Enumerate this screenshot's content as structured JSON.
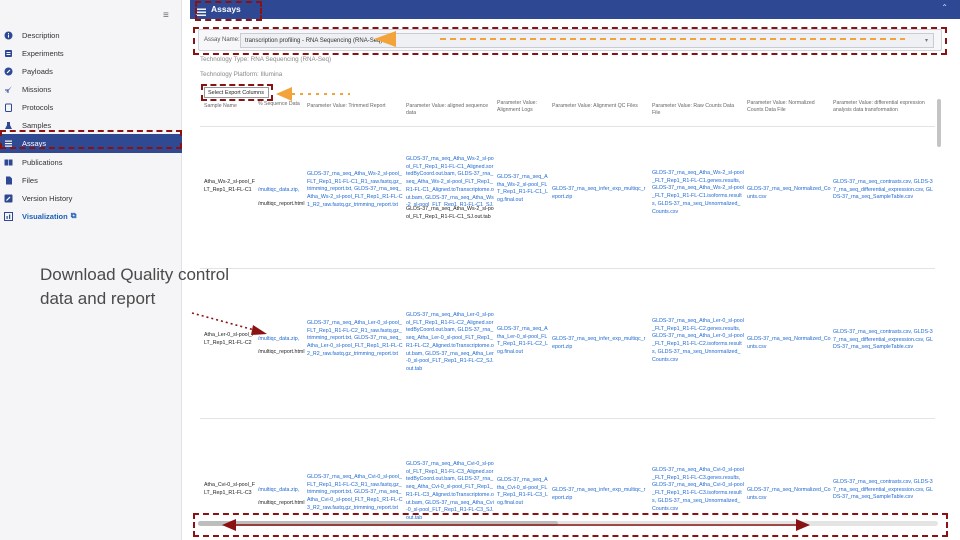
{
  "sidebar": {
    "items": [
      {
        "label": "Description",
        "icon": "info-circle-icon"
      },
      {
        "label": "Experiments",
        "icon": "flask-icon"
      },
      {
        "label": "Payloads",
        "icon": "rocket-icon"
      },
      {
        "label": "Missions",
        "icon": "rocket-launch-icon"
      },
      {
        "label": "Protocols",
        "icon": "clipboard-icon"
      },
      {
        "label": "Samples",
        "icon": "beaker-icon"
      },
      {
        "label": "Assays",
        "icon": "list-icon"
      },
      {
        "label": "Publications",
        "icon": "book-icon"
      },
      {
        "label": "Files",
        "icon": "file-icon"
      },
      {
        "label": "Version History",
        "icon": "edit-icon"
      },
      {
        "label": "Visualization",
        "icon": "chart-icon"
      }
    ],
    "active": "Assays"
  },
  "header": {
    "title": "Assays"
  },
  "assay": {
    "label": "Assay Name:",
    "value": "transcription profiling - RNA Sequencing (RNA-Seq)"
  },
  "technology_type": "Technology Type: RNA Sequencing (RNA-Seq)",
  "technology_platform": "Technology Platform: Illumina",
  "export_button": "Select Export Columns",
  "table": {
    "headers": [
      "Sample Name",
      "% Sequence Data",
      "Parameter Value: Trimmed Report",
      "Parameter Value: aligned sequence data",
      "Parameter Value: Alignment Logs",
      "Parameter Value: Alignment QC Files",
      "Parameter Value: Raw Counts Data File",
      "Parameter Value: Normalized Counts Data File",
      "Parameter Value: differential expression analysis data transformation"
    ],
    "rows": [
      {
        "sample": "Atha_Ws-2_sl-pool_FLT_Rep1_R1-FL-C1",
        "seq1": "/multiqc_data.zip,",
        "seq2": "/multiqc_report.html",
        "trimmed": "GLDS-37_rna_seq_Atha_Ws-2_sl-pool_FLT_Rep1_R1-FL-C1_R1_raw.fastq.gz_trimming_report.txt, GLDS-37_rna_seq_Atha_Ws-2_sl-pool_FLT_Rep1_R1-FL-C1_R2_raw.fastq.gz_trimming_report.txt",
        "aligned": "GLDS-37_rna_seq_Atha_Ws-2_sl-pool_FLT_Rep1_R1-FL-C1_Aligned.sortedByCoord.out.bam, GLDS-37_rna_seq_Atha_Ws-2_sl-pool_FLT_Rep1_R1-FL-C1_Aligned.toTranscriptome.out.bam, GLDS-37_rna_seq_Atha_Ws-2_sl-pool_FLT_Rep1_R1-FL-C1_SJ.out.tab",
        "aligned_dark": "GLDS-37_rna_seq_Atha_Ws-2_sl-pool_FLT_Rep1_R1-FL-C1_SJ.out.tab",
        "logs": "GLDS-37_rna_seq_Atha_Ws-2_sl-pool_FLT_Rep1_R1-FL-C1_Log.final.out",
        "qc": "GLDS-37_rna_seq_infer_exp_multiqc_report.zip",
        "raw": "GLDS-37_rna_seq_Atha_Ws-2_sl-pool_FLT_Rep1_R1-FL-C1.genes.results, GLDS-37_rna_seq_Atha_Ws-2_sl-pool_FLT_Rep1_R1-FL-C1.isoforms.results, GLDS-37_rna_seq_Unnormalized_Counts.csv",
        "norm": "GLDS-37_rna_seq_Normalized_Counts.csv",
        "diff": "GLDS-37_rna_seq_contrasts.csv, GLDS-37_rna_seq_differential_expression.csv, GLDS-37_rna_seq_SampleTable.csv"
      },
      {
        "sample": "Atha_Ler-0_sl-pool_FLT_Rep1_R1-FL-C2",
        "seq1": "/multiqc_data.zip,",
        "seq2": "/multiqc_report.html",
        "trimmed": "GLDS-37_rna_seq_Atha_Ler-0_sl-pool_FLT_Rep1_R1-FL-C2_R1_raw.fastq.gz_trimming_report.txt, GLDS-37_rna_seq_Atha_Ler-0_sl-pool_FLT_Rep1_R1-FL-C2_R2_raw.fastq.gz_trimming_report.txt",
        "aligned": "GLDS-37_rna_seq_Atha_Ler-0_sl-pool_FLT_Rep1_R1-FL-C2_Aligned.sortedByCoord.out.bam, GLDS-37_rna_seq_Atha_Ler-0_sl-pool_FLT_Rep1_R1-FL-C2_Aligned.toTranscriptome.out.bam, GLDS-37_rna_seq_Atha_Ler-0_sl-pool_FLT_Rep1_R1-FL-C2_SJ.out.tab",
        "logs": "GLDS-37_rna_seq_Atha_Ler-0_sl-pool_FLT_Rep1_R1-FL-C2_Log.final.out",
        "qc": "GLDS-37_rna_seq_infer_exp_multiqc_report.zip",
        "raw": "GLDS-37_rna_seq_Atha_Ler-0_sl-pool_FLT_Rep1_R1-FL-C2.genes.results, GLDS-37_rna_seq_Atha_Ler-0_sl-pool_FLT_Rep1_R1-FL-C2.isoforms.results, GLDS-37_rna_seq_Unnormalized_Counts.csv",
        "norm": "GLDS-37_rna_seq_Normalized_Counts.csv",
        "diff": "GLDS-37_rna_seq_contrasts.csv, GLDS-37_rna_seq_differential_expression.csv, GLDS-37_rna_seq_SampleTable.csv"
      },
      {
        "sample": "Atha_Cvi-0_sl-pool_FLT_Rep1_R1-FL-C3",
        "seq1": "/multiqc_data.zip,",
        "seq2": "/multiqc_report.html",
        "trimmed": "GLDS-37_rna_seq_Atha_Cvi-0_sl-pool_FLT_Rep1_R1-FL-C3_R1_raw.fastq.gz_trimming_report.txt, GLDS-37_rna_seq_Atha_Cvi-0_sl-pool_FLT_Rep1_R1-FL-C3_R2_raw.fastq.gz_trimming_report.txt",
        "aligned": "GLDS-37_rna_seq_Atha_Cvi-0_sl-pool_FLT_Rep1_R1-FL-C3_Aligned.sortedByCoord.out.bam, GLDS-37_rna_seq_Atha_Cvi-0_sl-pool_FLT_Rep1_R1-FL-C3_Aligned.toTranscriptome.out.bam, GLDS-37_rna_seq_Atha_Cvi-0_sl-pool_FLT_Rep1_R1-FL-C3_SJ.out.tab",
        "logs": "GLDS-37_rna_seq_Atha_Cvi-0_sl-pool_FLT_Rep1_R1-FL-C3_Log.final.out",
        "qc": "GLDS-37_rna_seq_infer_exp_multiqc_report.zip",
        "raw": "GLDS-37_rna_seq_Atha_Cvi-0_sl-pool_FLT_Rep1_R1-FL-C3.genes.results, GLDS-37_rna_seq_Atha_Cvi-0_sl-pool_FLT_Rep1_R1-FL-C3.isoforms.results, GLDS-37_rna_seq_Unnormalized_Counts.csv",
        "norm": "GLDS-37_rna_seq_Normalized_Counts.csv",
        "diff": "GLDS-37_rna_seq_contrasts.csv, GLDS-37_rna_seq_differential_expression.csv, GLDS-37_rna_seq_SampleTable.csv"
      }
    ]
  },
  "annotation": {
    "line1": "Download Quality control",
    "line2": "data and report",
    "color": "#8b1212",
    "arrow_color": "#f2a33a"
  },
  "colors": {
    "header_bg": "#2e4894",
    "active_bg": "#2f4a92",
    "link": "#1d68d1"
  }
}
